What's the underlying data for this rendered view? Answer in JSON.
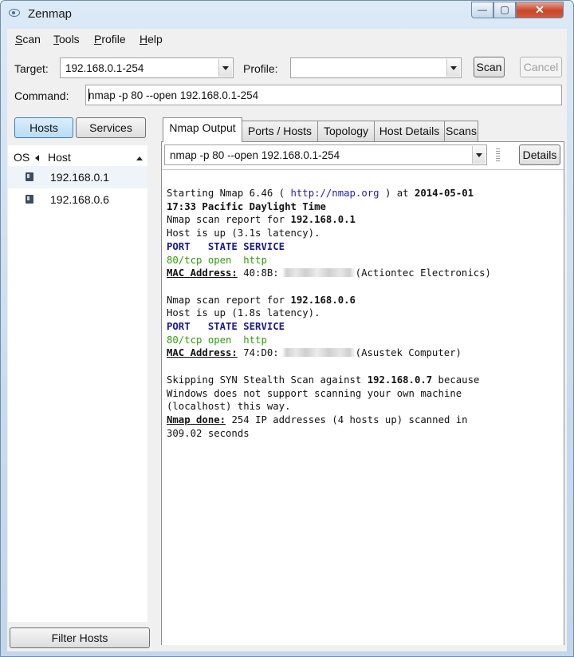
{
  "window": {
    "title": "Zenmap",
    "minimize_glyph": "—",
    "maximize_glyph": "▢",
    "close_glyph": "✕"
  },
  "menu": [
    {
      "accel": "S",
      "rest": "can"
    },
    {
      "accel": "T",
      "rest": "ools"
    },
    {
      "accel": "P",
      "rest": "rofile"
    },
    {
      "accel": "H",
      "rest": "elp"
    }
  ],
  "toolbar": {
    "target_label": "Target:",
    "target_value": "192.168.0.1-254",
    "profile_label": "Profile:",
    "profile_value": "",
    "scan_label": "Scan",
    "cancel_label": "Cancel",
    "command_label": "Command:",
    "command_value": "nmap -p 80 --open 192.168.0.1-254"
  },
  "left_panel": {
    "hosts_label": "Hosts",
    "services_label": "Services",
    "col_os": "OS",
    "col_host": "Host",
    "hosts": [
      "192.168.0.1",
      "192.168.0.6"
    ],
    "filter_label": "Filter Hosts"
  },
  "tabs": [
    "Nmap Output",
    "Ports / Hosts",
    "Topology",
    "Host Details",
    "Scans"
  ],
  "output_panel": {
    "scan_select": "nmap -p 80 --open 192.168.0.1-254",
    "details_label": "Details"
  },
  "output": {
    "start_prefix": "Starting Nmap 6.46 ( ",
    "start_url": "http://nmap.org",
    "start_mid": " ) at ",
    "start_date": "2014-05-01",
    "start_time": "17:33 Pacific Daylight Time",
    "report_prefix": "Nmap scan report for ",
    "host1_ip": "192.168.0.1",
    "host1_up": "Host is up (3.1s latency).",
    "port_header": "PORT   STATE SERVICE",
    "host1_port": "80/tcp open  http",
    "mac_label": "MAC Address:",
    "host1_mac": " 40:8B:",
    "host1_vendor": "(Actiontec Electronics)",
    "host2_ip": "192.168.0.6",
    "host2_up": "Host is up (1.8s latency).",
    "host2_port": "80/tcp open  http",
    "host2_mac": " 74:D0:",
    "host2_vendor": "(Asustek Computer)",
    "skip_prefix": "Skipping SYN Stealth Scan against ",
    "skip_ip": "192.168.0.7",
    "skip_suffix": " because",
    "skip_line2": "Windows does not support scanning your own machine",
    "skip_line3": "(localhost) this way.",
    "done_label": "Nmap done:",
    "done_rest": " 254 IP addresses (4 hosts up) scanned in",
    "done_line2": "309.02 seconds"
  }
}
